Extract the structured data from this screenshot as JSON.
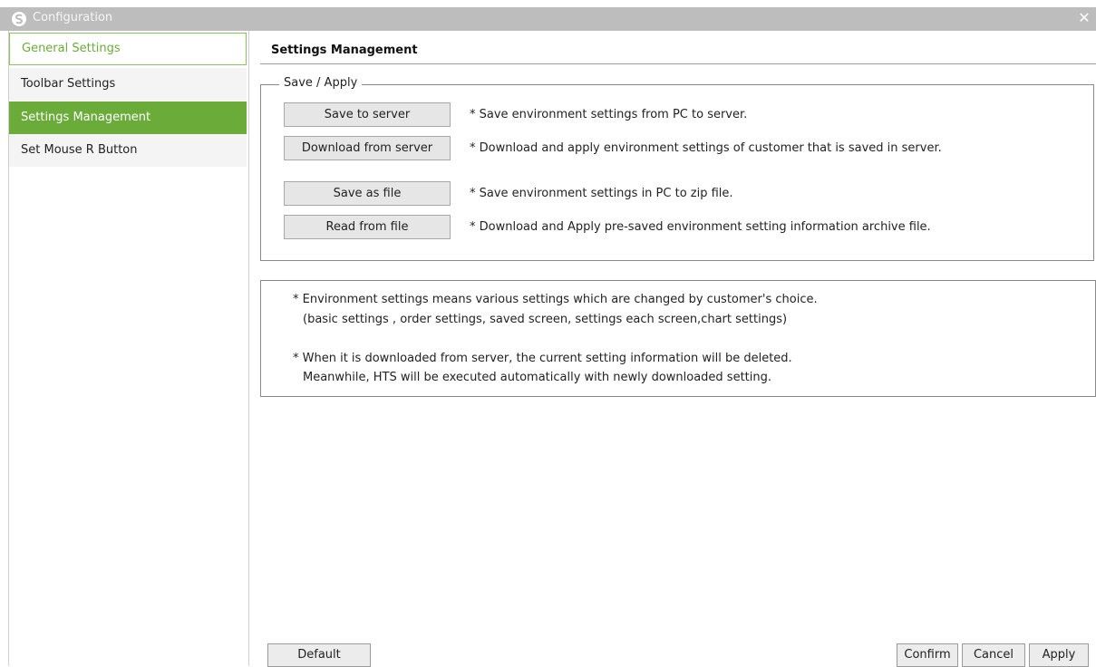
{
  "window": {
    "title": "Configuration",
    "close_glyph": "✕",
    "app_icon": "app-logo-icon"
  },
  "sidebar": {
    "items": [
      {
        "label": "General Settings"
      },
      {
        "label": "Toolbar Settings"
      },
      {
        "label": "Settings Management"
      },
      {
        "label": "Set Mouse R Button"
      }
    ],
    "active_index": 2,
    "accent_color": "#6aab3a"
  },
  "main": {
    "title": "Settings Management",
    "group": {
      "legend": "Save / Apply",
      "actions": [
        {
          "button": "Save to server",
          "description": "* Save environment settings from PC to server."
        },
        {
          "button": "Download from server",
          "description": "* Download and apply environment settings of customer that is saved in server."
        },
        {
          "button": "Save as file",
          "description": "* Save environment settings in PC to zip file."
        },
        {
          "button": "Read from file",
          "description": "* Download and Apply pre-saved environment setting information archive file."
        }
      ]
    },
    "notes": {
      "line1": "* Environment settings means various settings which are changed by customer's choice.",
      "line2": "(basic settings , order settings, saved screen, settings each screen,chart settings)",
      "line3": "* When it is downloaded from server, the current setting information will be deleted.",
      "line4": "Meanwhile, HTS will be executed automatically with newly downloaded setting."
    }
  },
  "footer": {
    "default_label": "Default",
    "confirm_label": "Confirm",
    "cancel_label": "Cancel",
    "apply_label": "Apply"
  }
}
